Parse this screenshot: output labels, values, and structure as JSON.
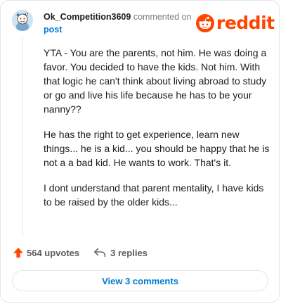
{
  "header": {
    "username": "Ok_Competition3609",
    "action": "commented on",
    "target": "post",
    "brand": "reddit"
  },
  "comment": {
    "paragraphs": [
      "YTA - You are the parents, not him. He was doing a favor. You decided to have the kids. Not him. With that logic he can't think about living abroad to study or go and live his life because he has to be your nanny??",
      "He has the right to get experience, learn new things... he is a kid... you should be happy that he is not a a bad kid. He wants to work. That's it.",
      "I dont understand that parent mentality, I have kids to be raised by the older kids..."
    ]
  },
  "actions": {
    "upvotes": "564 upvotes",
    "replies": "3 replies"
  },
  "footer": {
    "view_comments": "View 3 comments"
  },
  "colors": {
    "brand": "#ff4500",
    "link": "#0079d3"
  },
  "icons": {
    "avatar": "snoo-avatar-icon",
    "logo": "reddit-snoo-icon",
    "upvote": "upvote-arrow-icon",
    "reply": "reply-arrow-icon"
  }
}
